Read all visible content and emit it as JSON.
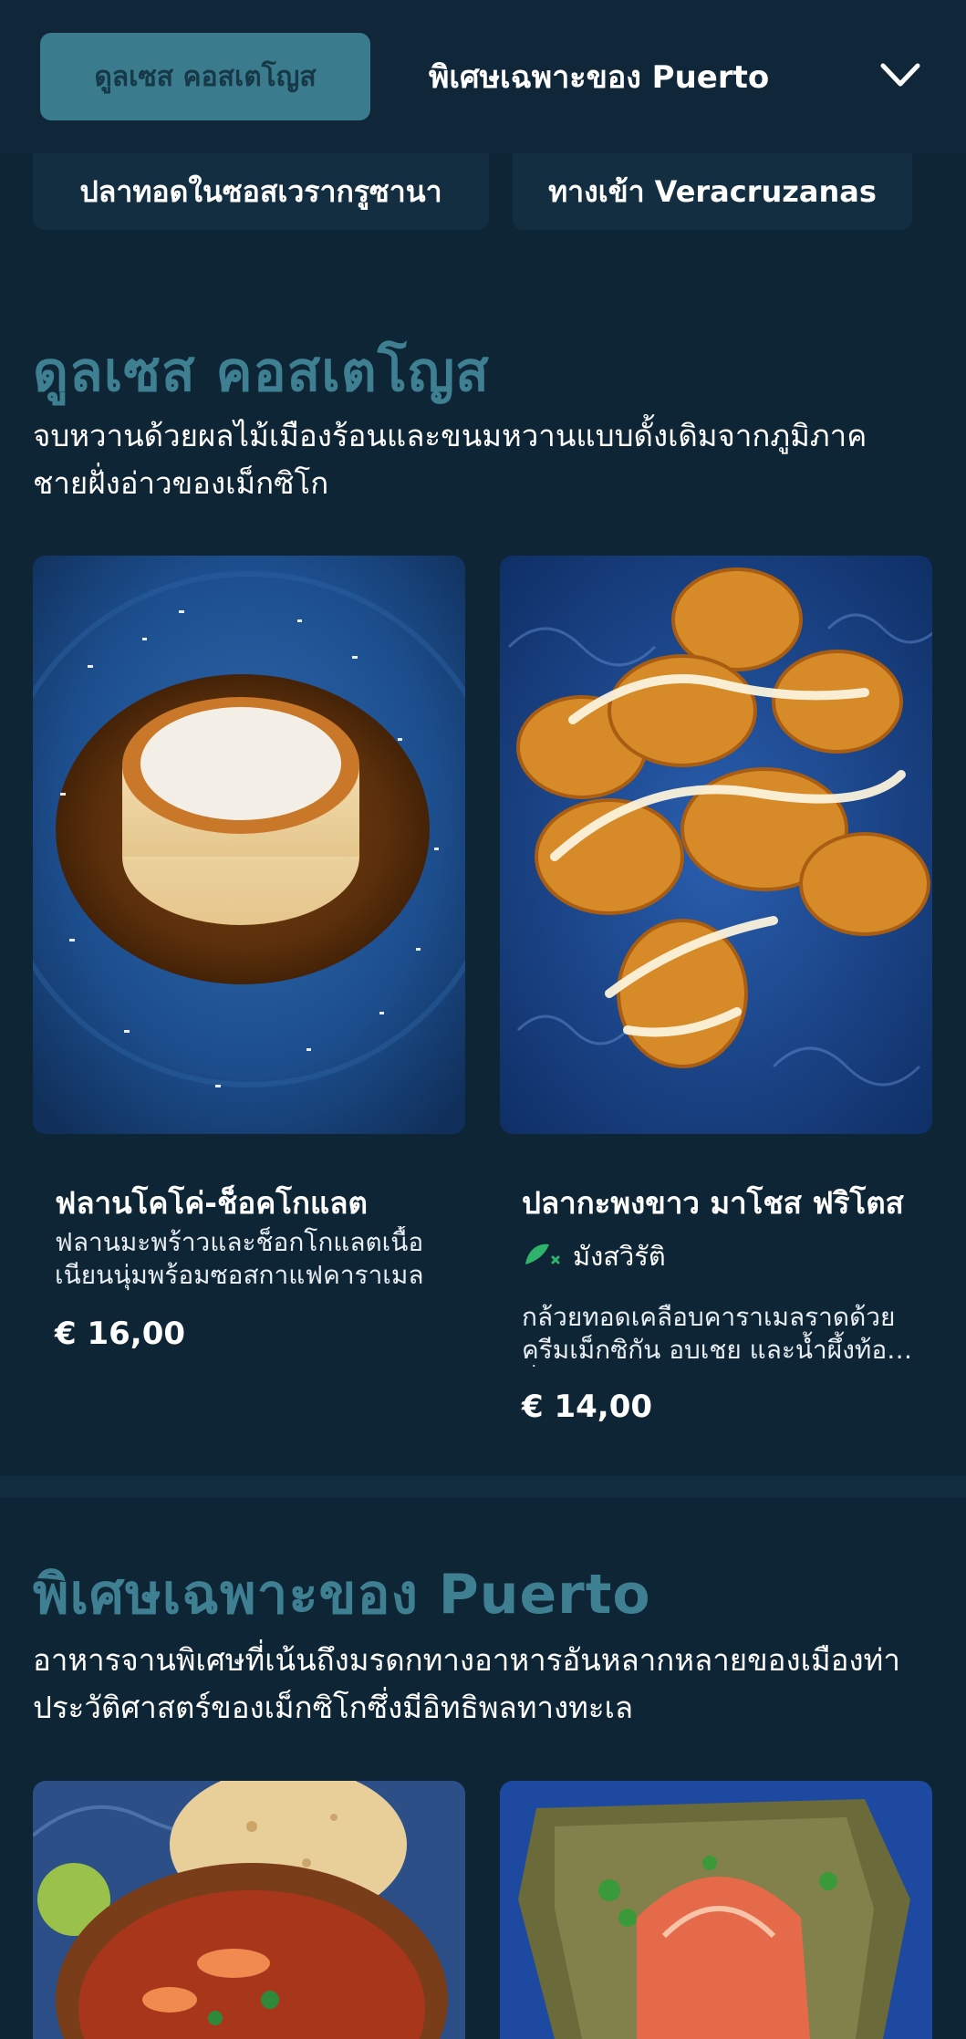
{
  "header": {
    "active_category": "ดูลเซส คอสเตโญส",
    "next_category": "พิเศษเฉพาะของ Puerto",
    "dropdown_icon": "chevron-down-icon"
  },
  "subcategories": [
    "ปลาทอดในซอสเวรากรูซานา",
    "ทางเข้า Veracruzanas"
  ],
  "sections": [
    {
      "title": "ดูลเซส คอสเตโญส",
      "description": "จบหวานด้วยผลไม้เมืองร้อนและขนมหวานแบบดั้งเดิมจากภูมิภาคชายฝั่งอ่าวของเม็กซิโก",
      "items": [
        {
          "name": "ฟลานโคโค่-ช็อคโกแลต",
          "description": "ฟลานมะพร้าวและช็อกโกแลตเนื้อเนียนนุ่มพร้อมซอสกาแฟคาราเมล",
          "price": "€ 16,00"
        },
        {
          "name": "ปลากะพงขาว มาโชส ฟริโตส",
          "tag": "มังสวิรัติ",
          "tag_icon": "leaf-drumstick-icon",
          "description": "กล้วยทอดเคลือบคาราเมลราดด้วยครีมเม็กซิกัน อบเชย และน้ำผึ้งท้องถิ่น",
          "price": "€ 14,00"
        }
      ]
    },
    {
      "title": "พิเศษเฉพาะของ Puerto",
      "description": "อาหารจานพิเศษที่เน้นถึงมรดกทางอาหารอันหลากหลายของเมืองท่าประวัติศาสตร์ของเม็กซิโกซึ่งมีอิทธิพลทางทะเล"
    }
  ],
  "colors": {
    "background": "#0e2536",
    "accent": "#3a7b8d",
    "section_title": "#3e7f92",
    "vegetarian_green": "#2fb36b"
  }
}
